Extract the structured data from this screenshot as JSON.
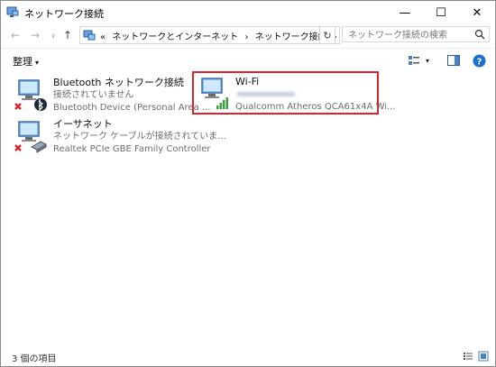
{
  "window": {
    "title": "ネットワーク接続",
    "minimize": "—",
    "maximize": "☐",
    "close": "✕"
  },
  "nav": {
    "back": "←",
    "forward": "→",
    "recent": "∨",
    "up": "↑",
    "breadcrumb_lead": "«",
    "breadcrumb": [
      "ネットワークとインターネット",
      "ネットワーク接続"
    ],
    "breadcrumb_sep": "›",
    "dropdown": "∨",
    "refresh": "↻",
    "search_placeholder": "ネットワーク接続の検索"
  },
  "toolbar": {
    "organize_label": "整理",
    "organize_arrow": "▾",
    "view_arrow": "▾",
    "help": "?"
  },
  "connections": [
    {
      "name": "Bluetooth ネットワーク接続",
      "status": "接続されていません",
      "device": "Bluetooth Device (Personal Area ...",
      "icon": "bluetooth-network-icon",
      "badge": "disconnected-x-icon"
    },
    {
      "name": "Wi-Fi",
      "status": "",
      "device": "Qualcomm Atheros QCA61x4A Wi...",
      "icon": "wifi-network-icon",
      "badge": "signal-bars-icon"
    },
    {
      "name": "イーサネット",
      "status": "ネットワーク ケーブルが接続されていま...",
      "device": "Realtek PCIe GBE Family Controller",
      "icon": "ethernet-network-icon",
      "badge": "disconnected-x-icon"
    }
  ],
  "statusbar": {
    "item_count": "3 個の項目"
  },
  "colors": {
    "selection_outline": "#d9232d",
    "help": "#1a6fd6",
    "disconnected": "#e0202a",
    "signal": "#3aa13a"
  }
}
